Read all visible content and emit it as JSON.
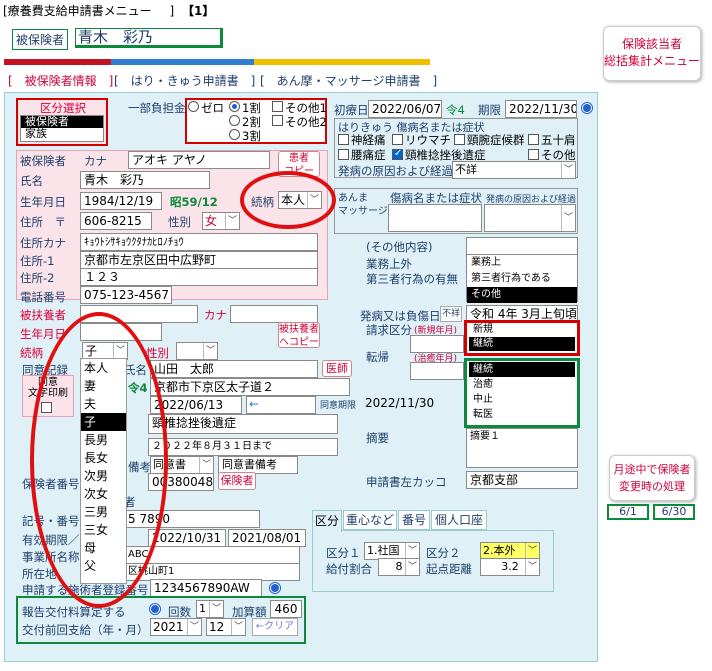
{
  "window": {
    "title": "[療養費支給申請書メニュー",
    "title_suffix": "]",
    "page_indicator": "【1】"
  },
  "header": {
    "insured_label": "被保険者",
    "insured_name": "青木　彩乃",
    "summary_button": [
      "保険該当者",
      "総括集計メニュー"
    ]
  },
  "tabs": [
    {
      "label": "[　被保険者情報　]"
    },
    {
      "label": "[　はり・きゅう申請書　]"
    },
    {
      "label": "[　あん摩・マッサージ申請書　]"
    }
  ],
  "kubun": {
    "title": "区分選択",
    "options": [
      "被保険者",
      "家族"
    ],
    "selected": 0
  },
  "burden": {
    "label": "一部負担金",
    "radios": [
      "ゼロ",
      "1割",
      "2割",
      "3割"
    ],
    "selected": 1,
    "checks": [
      "その他1",
      "その他2"
    ]
  },
  "insured": {
    "label_insured": "被保険者",
    "label_kana": "カナ",
    "kana": "アオキ アヤノ",
    "label_name": "氏名",
    "name": "青木　彩乃",
    "copy_button": [
      "患者",
      "コピー"
    ],
    "label_birth": "生年月日",
    "birth": "1984/12/19",
    "birth_era": "昭59/12",
    "label_relation": "続柄",
    "relation": "本人",
    "label_address": "住所　〒",
    "postal": "606-8215",
    "label_sex": "性別",
    "sex": "女",
    "label_address_kana": "住所カナ",
    "address_kana": "ｷｮｳﾄｼｻｷｮｳｸﾀﾅｶﾋﾛﾉﾁｮｳ",
    "label_address1": "住所-1",
    "address1": "京都市左京区田中広野町",
    "label_address2": "住所-2",
    "address2": "１２３",
    "label_tel": "電話番号",
    "tel": "075-123-4567"
  },
  "dependent": {
    "label_supporter": "被扶養者",
    "label_kana": "カナ",
    "label_birth": "生年月日",
    "label_relation": "続柄",
    "relation": "子",
    "label_sex": "性別",
    "copy_button": [
      "被扶養者",
      "へコピー"
    ]
  },
  "relation_dropdown": [
    "本人",
    "妻",
    "夫",
    "子",
    "長男",
    "長女",
    "次男",
    "次女",
    "三男",
    "三女",
    "母",
    "父"
  ],
  "relation_dropdown_selected": 3,
  "consent": {
    "label_record": "同意記録",
    "label_print": [
      "同意",
      "文字印刷"
    ],
    "label_doctor_name": "氏名",
    "doctor_name": "山田　太郎",
    "doctor_button": "医師",
    "fragment_rei": "令4",
    "address": "京都市下京区太子道２",
    "date": "2022/06/13",
    "arrow": "←",
    "label_period": "同意期限",
    "period": "2022/11/30",
    "disease": "頸椎捻挫後遺症",
    "note": "２０２２年８月３１日まで",
    "label_last": "最終",
    "label_remark": "備考",
    "doctor_select": "同意書",
    "remark_select": "同意書備考"
  },
  "insurer": {
    "label_number": "保険者番号",
    "number": "00380048",
    "button": "保険者",
    "fragment_sha": "者",
    "label_symbol": "記号・番号",
    "symbol": "5 7890",
    "label_validity": "有効期限／",
    "valid_from": "2022/10/31",
    "valid_to": "2021/08/01",
    "label_office": "事業所名称",
    "office": "ABC",
    "label_location": "所在地",
    "location": "区桃山町1",
    "label_reg": "申請する施術者登録番号",
    "reg": "1234567890AW"
  },
  "report": {
    "label_report": "報告交付料算定する",
    "label_count": "回数",
    "count": "1",
    "label_add": "加算額",
    "add": "460",
    "label_prev": "交付前回支給（年・月）",
    "year": "2021",
    "month": "12",
    "clear_button": "←クリア"
  },
  "right": {
    "label_onset": "初療日",
    "onset": "2022/06/07",
    "onset_era": "令4",
    "label_due": "期限",
    "due": "2022/11/30",
    "hari_title": "はりきゅう 傷病名または症状",
    "hari_checks": [
      "神経痛",
      "リウマチ",
      "頸腕症候群",
      "五十肩",
      "腰痛症",
      "頸椎捻挫後遺症",
      "その他"
    ],
    "label_cause": "発病の原因および経過",
    "cause": "不詳",
    "anma_title": [
      "あんま",
      "マッサージ"
    ],
    "anma_label": "傷病名または症状",
    "anma_cause": "発病の原因および経過",
    "other_content": "(その他内容)",
    "label_work": "業務上外",
    "label_third": "第三者行為の有無",
    "work_options": [
      "業務上",
      "第三者行為である",
      "その他"
    ],
    "work_selected": 2,
    "label_injury": "発病又は負傷日",
    "injury_button": "不祥",
    "injury_date": "令和 4年 3月上旬頃",
    "label_request": "請求区分",
    "request_hint": "(新規年月)",
    "request_options": [
      "新規",
      "継続"
    ],
    "request_selected": 1,
    "label_outcome": "転帰",
    "outcome_hint": "(治癒年月)",
    "outcome_options": [
      "継続",
      "治癒",
      "中止",
      "転医"
    ],
    "outcome_selected": 0,
    "label_summary": "摘要",
    "summary": "摘要１",
    "label_left_kakko": "申請書左カッコ",
    "left_kakko": "京都支部"
  },
  "lower_tabs": [
    "区分",
    "重心など",
    "番号",
    "個人口座"
  ],
  "lower": {
    "label_k1": "区分１",
    "k1": "1.社国",
    "label_k2": "区分２",
    "k2": "2.本外",
    "label_rate": "給付割合",
    "rate": "8",
    "label_dist": "起点距離",
    "dist": "3.2"
  },
  "side_button": [
    "月途中で保険者",
    "変更時の処理"
  ],
  "pager": [
    "6/1",
    "6/30"
  ],
  "colors": {
    "accent_green": "#0a8a3a",
    "panel": "#dff0f7",
    "red": "#d40000",
    "tab_red": "#c1121f",
    "tab_blue": "#2f7fd0",
    "tab_yellow": "#f0c000"
  }
}
